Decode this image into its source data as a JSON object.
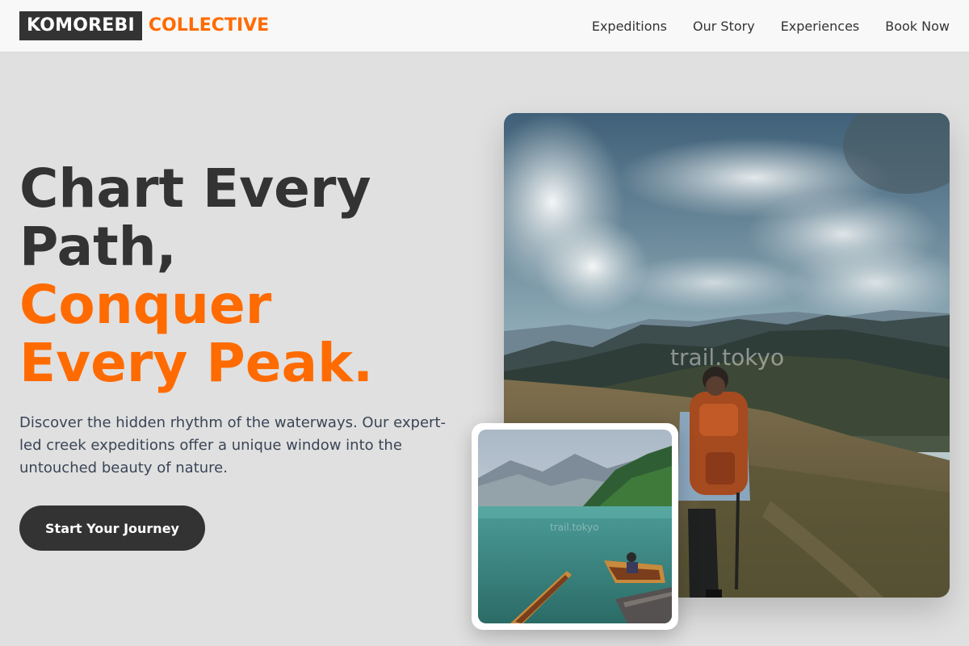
{
  "header": {
    "logo_primary": "KOMOREBI",
    "logo_secondary": "COLLECTIVE",
    "nav": [
      "Expeditions",
      "Our Story",
      "Experiences",
      "Book Now"
    ]
  },
  "hero": {
    "title_line1": "Chart Every",
    "title_line2": "Path,",
    "title_accent1": "Conquer",
    "title_accent2": "Every Peak.",
    "description": "Discover the hidden rhythm of the waterways. Our expert-led creek expeditions offer a unique window into the untouched beauty of nature.",
    "cta_label": "Start Your Journey"
  },
  "images": {
    "main_watermark": "trail.tokyo",
    "inset_watermark": "trail.tokyo"
  },
  "colors": {
    "accent": "#ff6b00",
    "dark": "#333333",
    "background": "#e0e0e0"
  }
}
